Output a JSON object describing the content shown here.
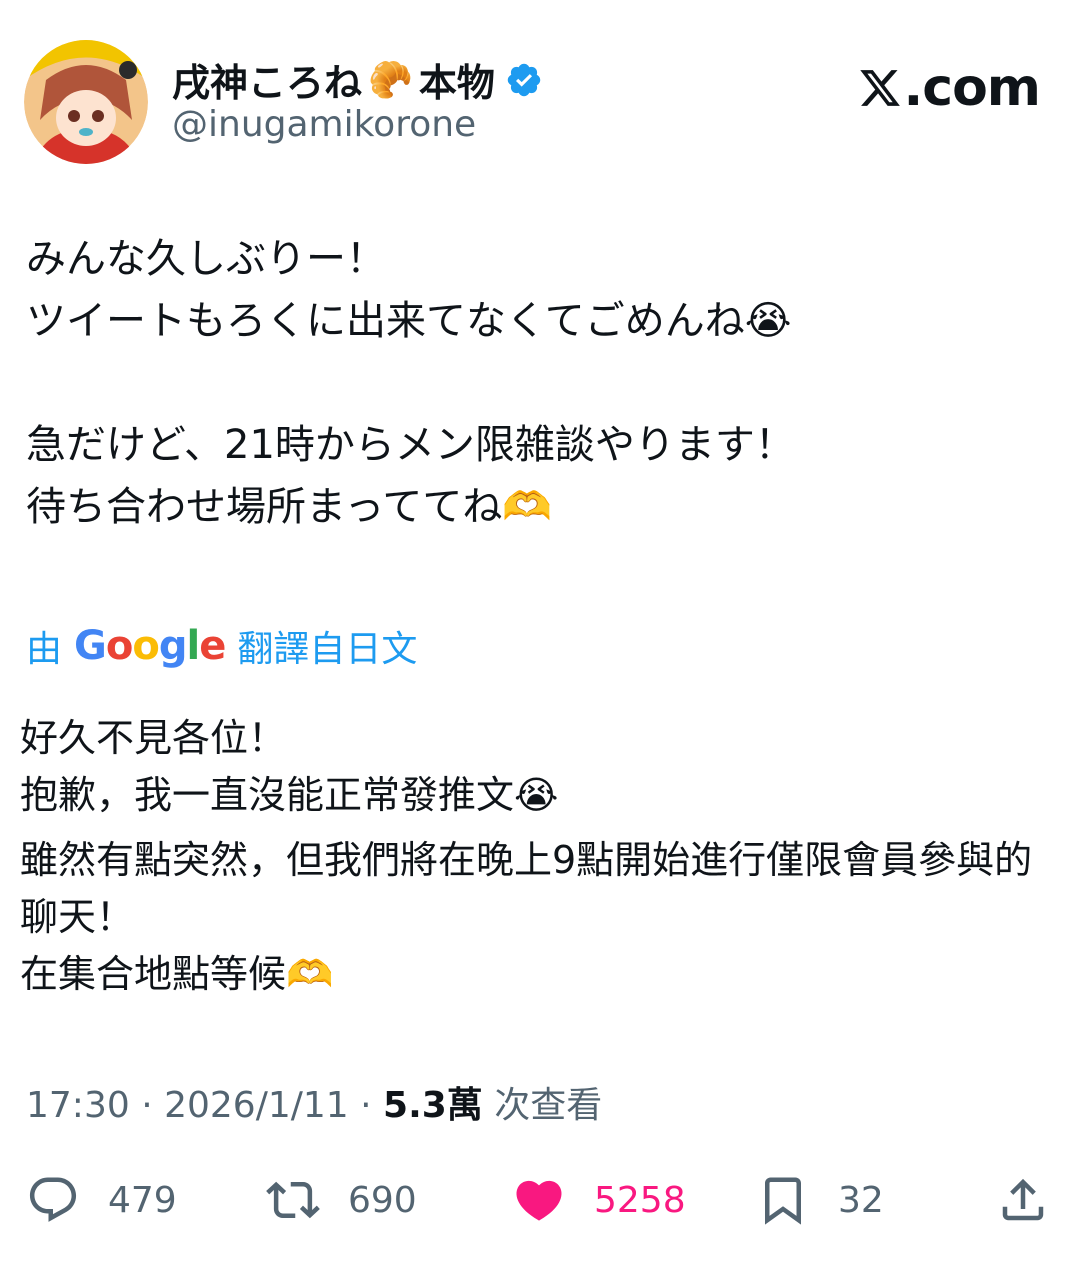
{
  "author": {
    "name": "戌神ころね",
    "name_suffix": "本物",
    "handle": "@inugamikorone"
  },
  "site": {
    "label": ".com"
  },
  "tweet": {
    "original_lines": [
      "みんな久しぶりー！",
      "ツイートもろくに出来てなくてごめんね😭",
      "",
      "急だけど、21時からメン限雑談やります！",
      "待ち合わせ場所まっててね🫶"
    ],
    "translation_label_prefix": "由",
    "translation_provider": "Google",
    "translation_label_suffix": "翻譯自日文",
    "translated_lines": [
      "好久不見各位！",
      "抱歉，我一直沒能正常發推文😭",
      "雖然有點突然，但我們將在晚上9點開始進行僅限會員參與的聊天！",
      "在集合地點等候🫶"
    ]
  },
  "meta": {
    "time": "17:30",
    "date": "2026/1/11",
    "views": "5.3萬",
    "views_label": "次查看"
  },
  "actions": {
    "replies": "479",
    "reposts": "690",
    "likes": "5258",
    "bookmarks": "32"
  },
  "colors": {
    "accent": "#1d9bf0",
    "like": "#f91880",
    "secondary_text": "#536471"
  }
}
